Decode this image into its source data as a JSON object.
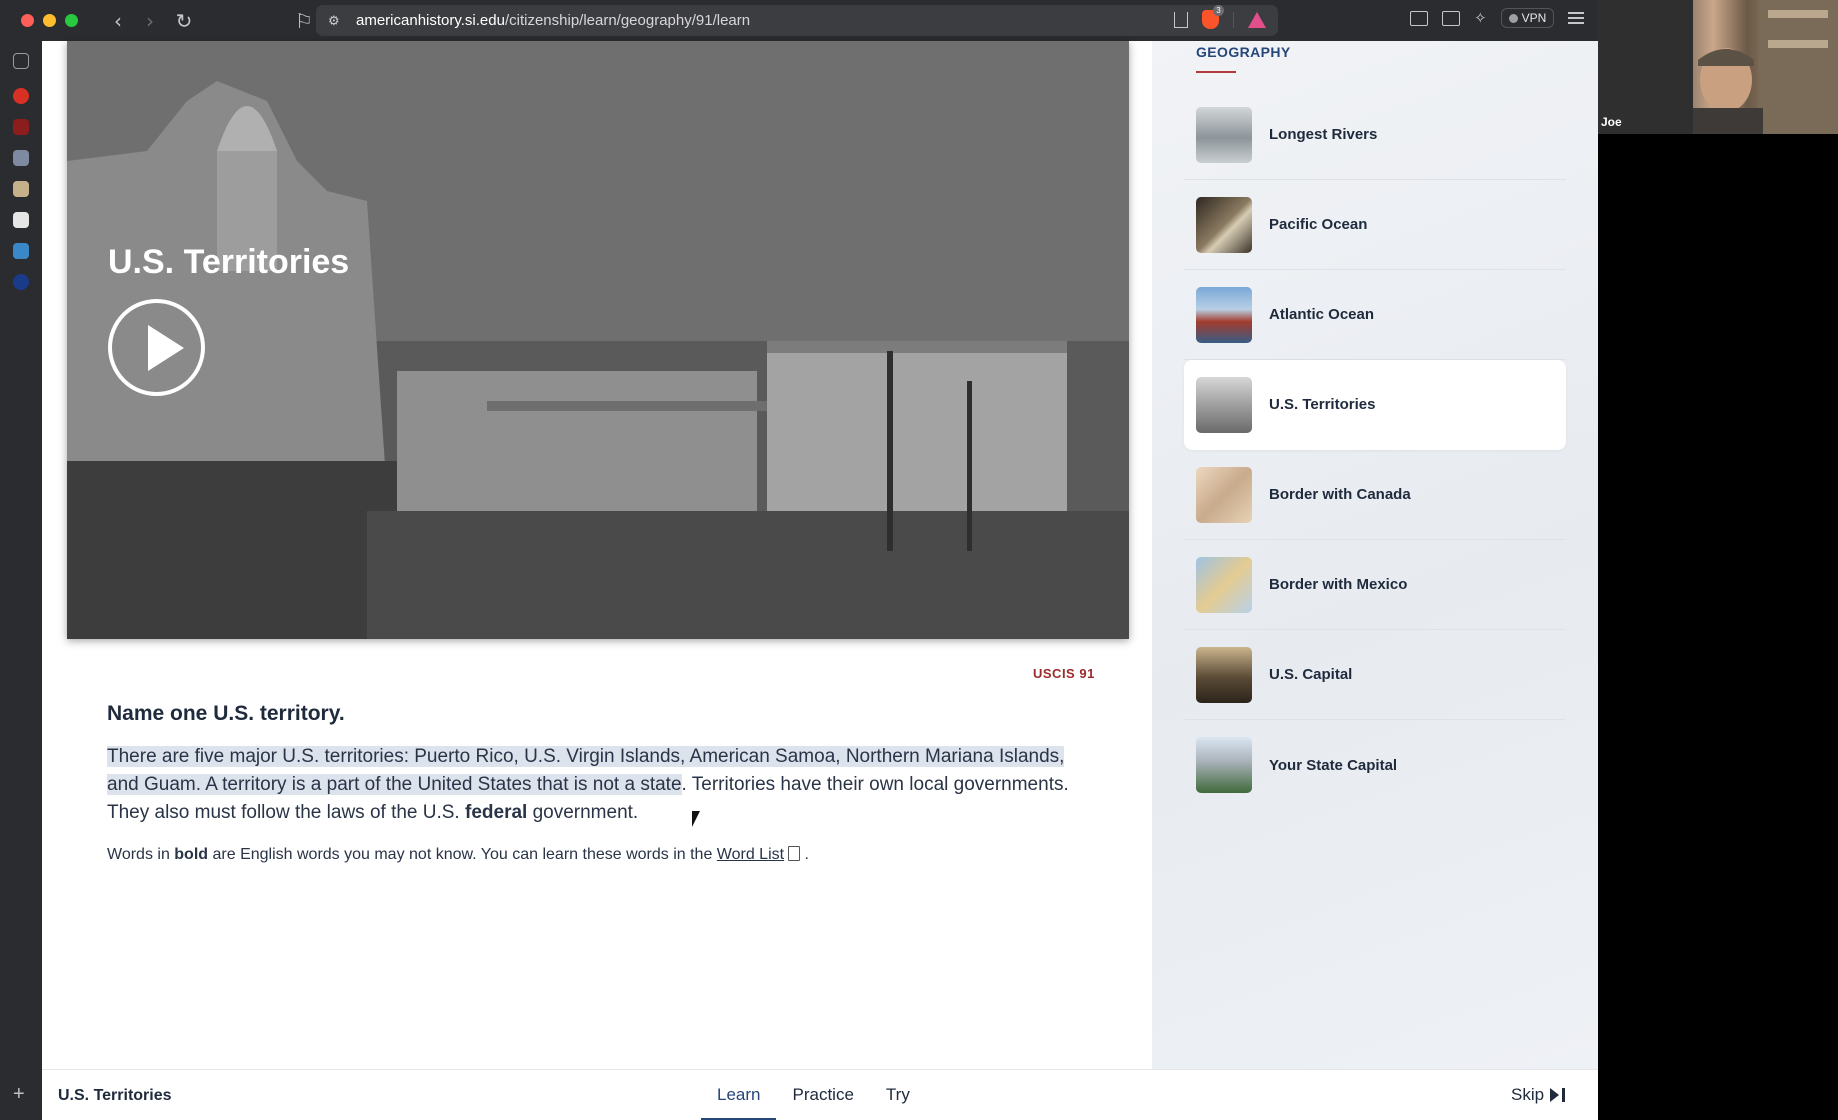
{
  "browser": {
    "url_host": "americanhistory.si.edu",
    "url_path": "/citizenship/learn/geography/91/learn",
    "vpn_label": "VPN",
    "brave_badge": "3"
  },
  "video": {
    "title": "U.S. Territories"
  },
  "content": {
    "uscis_label": "USCIS 91",
    "question": "Name one U.S. territory.",
    "answer_highlighted": "There are five major U.S. territories: Puerto Rico, U.S. Virgin Islands, American Samoa, Northern Mariana Islands, and Guam. A territory is a part of the United States that is not a state",
    "answer_rest_1": ". Territories have their own local governments. They also must follow the laws of the U.S. ",
    "answer_bold": "federal",
    "answer_rest_2": " government.",
    "note_prefix": "Words in ",
    "note_bold": "bold",
    "note_middle": " are English words you may not know. You can learn these words in the ",
    "note_link": "Word List",
    "note_suffix": " ."
  },
  "sidebar": {
    "title": "GEOGRAPHY",
    "items": [
      {
        "label": "Longest Rivers",
        "active": false
      },
      {
        "label": "Pacific Ocean",
        "active": false
      },
      {
        "label": "Atlantic Ocean",
        "active": false
      },
      {
        "label": "U.S. Territories",
        "active": true
      },
      {
        "label": "Border with Canada",
        "active": false
      },
      {
        "label": "Border with Mexico",
        "active": false
      },
      {
        "label": "U.S. Capital",
        "active": false
      },
      {
        "label": "Your State Capital",
        "active": false
      }
    ]
  },
  "bottombar": {
    "title": "U.S. Territories",
    "tabs": [
      {
        "label": "Learn",
        "active": true
      },
      {
        "label": "Practice",
        "active": false
      },
      {
        "label": "Try",
        "active": false
      }
    ],
    "skip_label": "Skip"
  },
  "webcam": {
    "name": "Joe"
  },
  "colors": {
    "accent": "#27467a",
    "uscis_red": "#9b2b2b",
    "text_dark": "#1f2a3c"
  }
}
